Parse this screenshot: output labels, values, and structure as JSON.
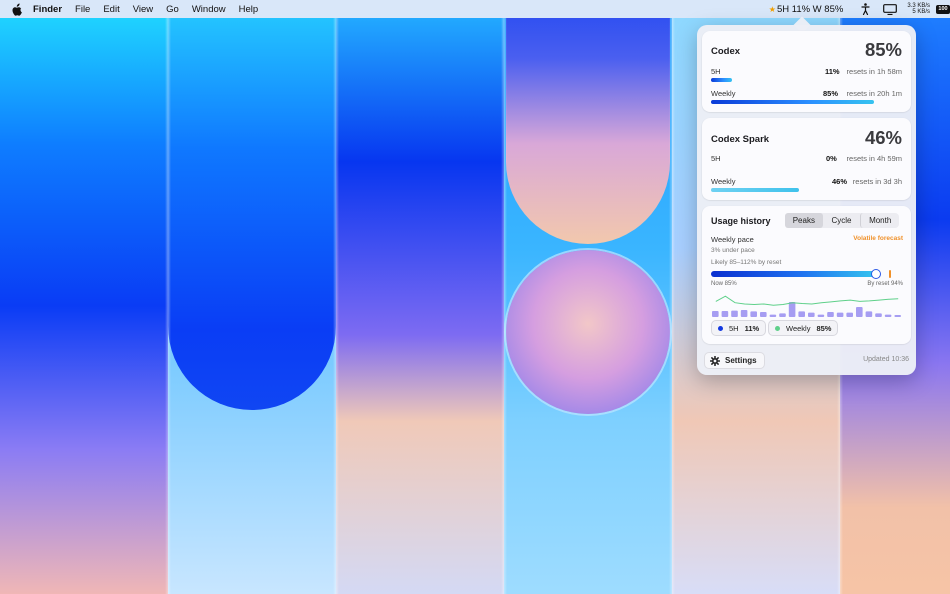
{
  "menubar": {
    "app_name": "Finder",
    "menus": [
      "File",
      "Edit",
      "View",
      "Go",
      "Window",
      "Help"
    ],
    "status_text": "5H 11% W 85%",
    "network_up": "3.3 KB/s",
    "network_down": "5 KB/s",
    "battery": "100"
  },
  "popover": {
    "codex": {
      "title": "Codex",
      "percent": "85%",
      "rows": [
        {
          "label": "5H",
          "pct": "11%",
          "reset": "resets in 1h 58m",
          "fill": 0.11
        },
        {
          "label": "Weekly",
          "pct": "85%",
          "reset": "resets in 20h 1m",
          "fill": 0.85
        }
      ]
    },
    "spark": {
      "title": "Codex Spark",
      "percent": "46%",
      "rows": [
        {
          "label": "5H",
          "pct": "0%",
          "reset": "resets in 4h 59m",
          "fill": 0.0
        },
        {
          "label": "Weekly",
          "pct": "46%",
          "reset": "resets in 3d 3h",
          "fill": 0.46
        }
      ]
    },
    "history": {
      "title": "Usage history",
      "tabs": [
        "Peaks",
        "Cycle",
        "Month"
      ],
      "active_tab": "Peaks",
      "pace_label": "Weekly pace",
      "forecast": "Volatile forecast",
      "under_pace": "3% under pace",
      "likely": "Likely 85–112% by reset",
      "now_label": "Now 85%",
      "by_reset_label": "By reset 94%",
      "pace_value": 0.85,
      "legend": [
        {
          "name": "5H",
          "value": "11%",
          "color": "#1238e0"
        },
        {
          "name": "Weekly",
          "value": "85%",
          "color": "#5fd08a"
        }
      ]
    },
    "settings_label": "Settings",
    "updated": "Updated 10:36"
  },
  "chart_data": {
    "type": "bar",
    "series": [
      {
        "name": "5H",
        "values": [
          30,
          30,
          32,
          35,
          28,
          25,
          12,
          18,
          75,
          28,
          22,
          12,
          25,
          22,
          22,
          50,
          28,
          18,
          12,
          10
        ]
      },
      {
        "name": "Weekly",
        "values": [
          60,
          80,
          55,
          50,
          48,
          50,
          45,
          48,
          55,
          52,
          50,
          55,
          58,
          62,
          65,
          60,
          62,
          65,
          68,
          70
        ]
      }
    ],
    "ylim": [
      0,
      100
    ]
  }
}
